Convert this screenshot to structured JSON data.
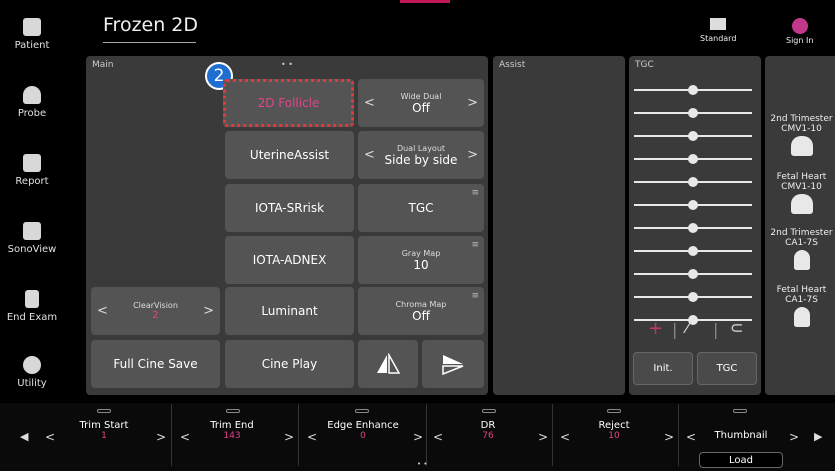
{
  "sidebar": {
    "items": [
      {
        "label": "Patient"
      },
      {
        "label": "Probe"
      },
      {
        "label": "Report"
      },
      {
        "label": "SonoView"
      },
      {
        "label": "End Exam"
      },
      {
        "label": "Utility"
      }
    ]
  },
  "header": {
    "title": "Frozen 2D",
    "standard_label": "Standard",
    "signin_label": "Sign In",
    "page_dots": "• •"
  },
  "main": {
    "label": "Main",
    "badge": "2",
    "follicle_label": "2D Follicle",
    "wide_dual": {
      "title": "Wide Dual",
      "value": "Off"
    },
    "uterine_label": "UterineAssist",
    "dual_layout": {
      "title": "Dual Layout",
      "value": "Side by side"
    },
    "iota_srrisk_label": "IOTA-SRrisk",
    "tgc_label": "TGC",
    "iota_adnex_label": "IOTA-ADNEX",
    "gray_map": {
      "title": "Gray Map",
      "value": "10"
    },
    "clearvision": {
      "title": "ClearVision",
      "value": "2"
    },
    "luminant_label": "Luminant",
    "chroma_map": {
      "title": "Chroma Map",
      "value": "Off"
    },
    "full_cine_save_label": "Full Cine Save",
    "cine_play_label": "Cine Play"
  },
  "assist": {
    "label": "Assist"
  },
  "tgc": {
    "label": "TGC",
    "knob_levels": [
      0.5,
      0.5,
      0.5,
      0.5,
      0.5,
      0.5,
      0.5,
      0.5,
      0.5,
      0.5,
      0.5
    ],
    "init_label": "Init.",
    "tgc_button_label": "TGC"
  },
  "probes": [
    {
      "name": "2nd Trimester",
      "probe": "CMV1-10"
    },
    {
      "name": "Fetal Heart",
      "probe": "CMV1-10"
    },
    {
      "name": "2nd Trimester",
      "probe": "CA1-7S"
    },
    {
      "name": "Fetal Heart",
      "probe": "CA1-7S"
    }
  ],
  "bottom": {
    "trim_start": {
      "label": "Trim Start",
      "value": "1"
    },
    "trim_end": {
      "label": "Trim End",
      "value": "143"
    },
    "edge_enhance": {
      "label": "Edge Enhance",
      "value": "0"
    },
    "dr": {
      "label": "DR",
      "value": "76"
    },
    "reject": {
      "label": "Reject",
      "value": "10"
    },
    "thumbnail": {
      "label": "Thumbnail",
      "load_label": "Load"
    },
    "page_dots": "• •"
  },
  "colors": {
    "accent": "#e2458a",
    "highlight_border": "#e03a3a",
    "badge": "#1f6fd1"
  }
}
